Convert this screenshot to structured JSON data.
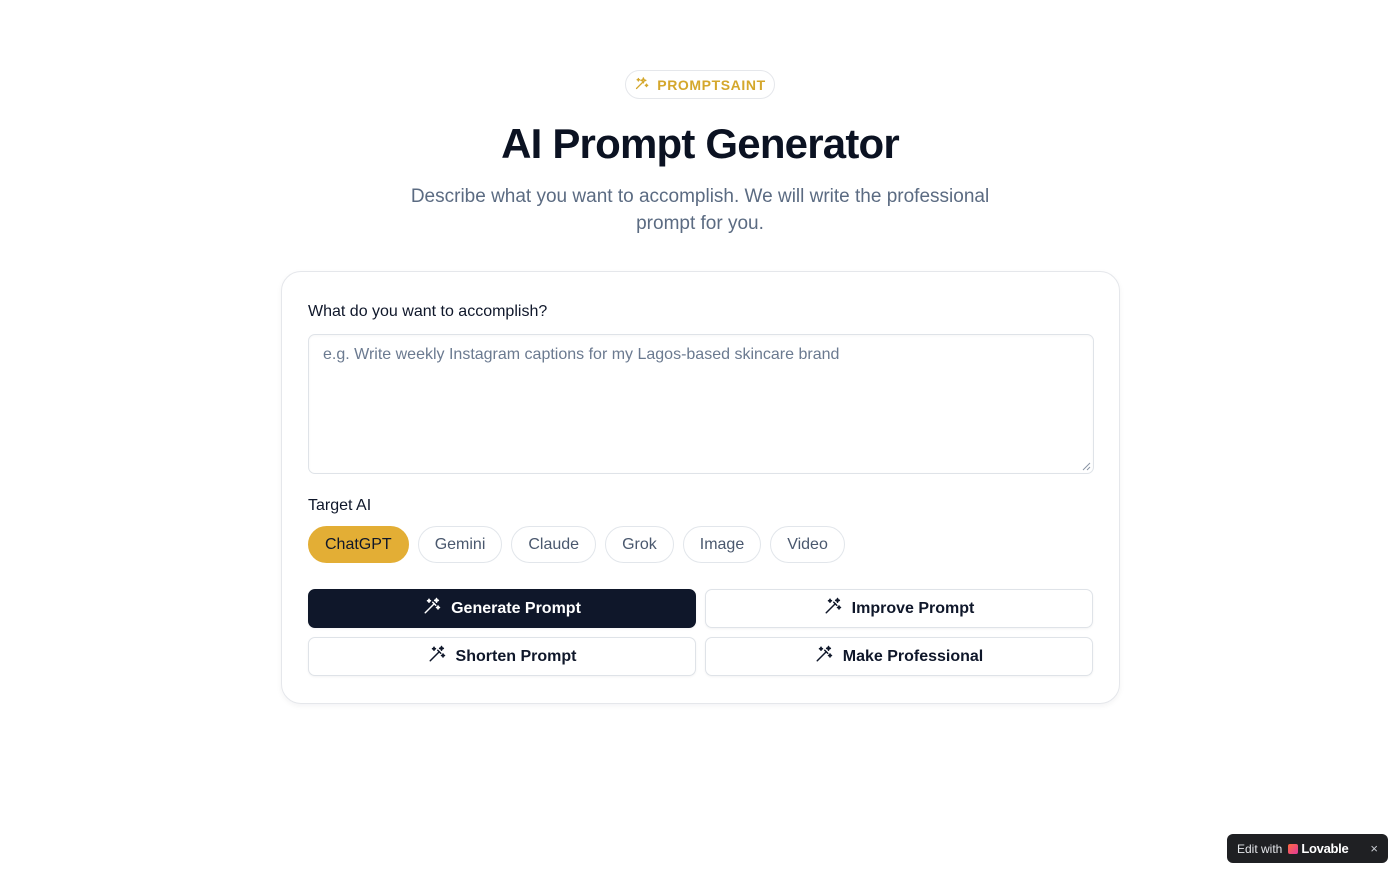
{
  "header": {
    "badge_label": "PROMPTSAINT",
    "badge_icon": "sparkles-icon",
    "title": "AI Prompt Generator",
    "subtitle": "Describe what you want to accomplish. We will write the professional prompt for you."
  },
  "form": {
    "goal_label": "What do you want to accomplish?",
    "goal_value": "",
    "goal_placeholder": "e.g. Write weekly Instagram captions for my Lagos-based skincare brand",
    "target_label": "Target AI",
    "targets": [
      {
        "label": "ChatGPT",
        "selected": true
      },
      {
        "label": "Gemini",
        "selected": false
      },
      {
        "label": "Claude",
        "selected": false
      },
      {
        "label": "Grok",
        "selected": false
      },
      {
        "label": "Image",
        "selected": false
      },
      {
        "label": "Video",
        "selected": false
      }
    ]
  },
  "actions": {
    "generate": "Generate Prompt",
    "improve": "Improve Prompt",
    "shorten": "Shorten Prompt",
    "professional": "Make Professional",
    "icon": "magic-wand-icon"
  },
  "lovable_badge": {
    "prefix": "Edit with",
    "brand": "Lovable",
    "close": "×"
  },
  "colors": {
    "accent": "#e3ae35",
    "badge_text": "#d4a72c",
    "primary_button": "#0f172a",
    "subtitle_text": "#5b6b82"
  }
}
